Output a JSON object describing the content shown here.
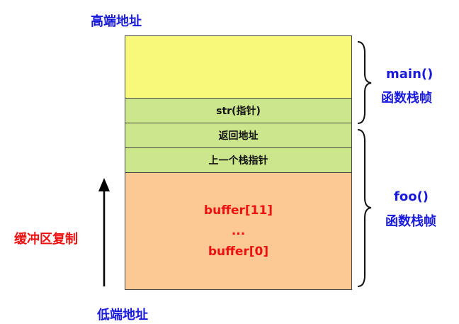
{
  "labels": {
    "high_address": "高端地址",
    "low_address": "低端地址",
    "main_func": "main()",
    "main_frame": "函数栈帧",
    "foo_func": "foo()",
    "foo_frame": "函数栈帧",
    "buffer_copy": "缓冲区复制"
  },
  "stack": {
    "str_pointer": "str(指针)",
    "return_address": "返回地址",
    "prev_stack_pointer": "上一个栈指针",
    "buffer_top": "buffer[11]",
    "buffer_dots": "...",
    "buffer_bottom": "buffer[0]"
  },
  "colors": {
    "main_top": "#f8f97b",
    "green_rows": "#cce68c",
    "buffer": "#fcc894",
    "label_blue": "#1a1adb",
    "label_red": "#ee1111"
  }
}
